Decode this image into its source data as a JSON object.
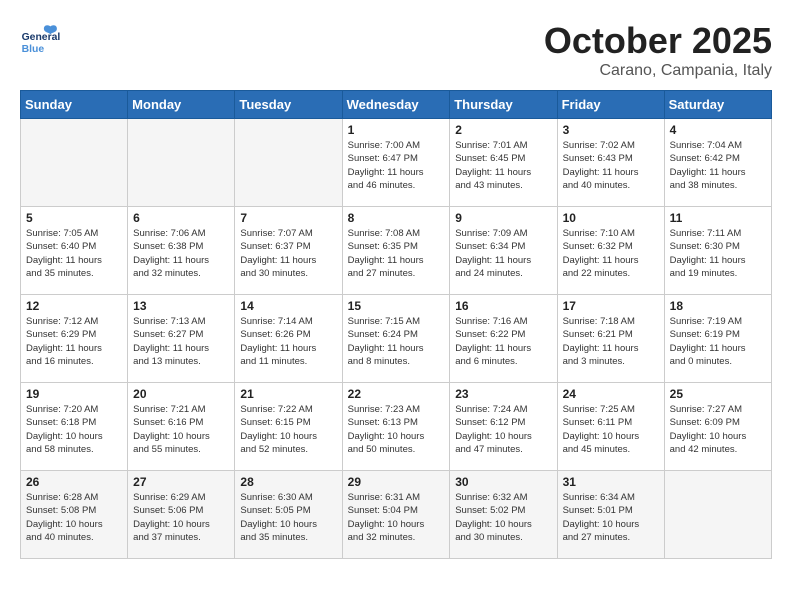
{
  "header": {
    "logo_general": "General",
    "logo_blue": "Blue",
    "month_title": "October 2025",
    "location": "Carano, Campania, Italy"
  },
  "weekdays": [
    "Sunday",
    "Monday",
    "Tuesday",
    "Wednesday",
    "Thursday",
    "Friday",
    "Saturday"
  ],
  "weeks": [
    [
      {
        "day": "",
        "info": ""
      },
      {
        "day": "",
        "info": ""
      },
      {
        "day": "",
        "info": ""
      },
      {
        "day": "1",
        "info": "Sunrise: 7:00 AM\nSunset: 6:47 PM\nDaylight: 11 hours\nand 46 minutes."
      },
      {
        "day": "2",
        "info": "Sunrise: 7:01 AM\nSunset: 6:45 PM\nDaylight: 11 hours\nand 43 minutes."
      },
      {
        "day": "3",
        "info": "Sunrise: 7:02 AM\nSunset: 6:43 PM\nDaylight: 11 hours\nand 40 minutes."
      },
      {
        "day": "4",
        "info": "Sunrise: 7:04 AM\nSunset: 6:42 PM\nDaylight: 11 hours\nand 38 minutes."
      }
    ],
    [
      {
        "day": "5",
        "info": "Sunrise: 7:05 AM\nSunset: 6:40 PM\nDaylight: 11 hours\nand 35 minutes."
      },
      {
        "day": "6",
        "info": "Sunrise: 7:06 AM\nSunset: 6:38 PM\nDaylight: 11 hours\nand 32 minutes."
      },
      {
        "day": "7",
        "info": "Sunrise: 7:07 AM\nSunset: 6:37 PM\nDaylight: 11 hours\nand 30 minutes."
      },
      {
        "day": "8",
        "info": "Sunrise: 7:08 AM\nSunset: 6:35 PM\nDaylight: 11 hours\nand 27 minutes."
      },
      {
        "day": "9",
        "info": "Sunrise: 7:09 AM\nSunset: 6:34 PM\nDaylight: 11 hours\nand 24 minutes."
      },
      {
        "day": "10",
        "info": "Sunrise: 7:10 AM\nSunset: 6:32 PM\nDaylight: 11 hours\nand 22 minutes."
      },
      {
        "day": "11",
        "info": "Sunrise: 7:11 AM\nSunset: 6:30 PM\nDaylight: 11 hours\nand 19 minutes."
      }
    ],
    [
      {
        "day": "12",
        "info": "Sunrise: 7:12 AM\nSunset: 6:29 PM\nDaylight: 11 hours\nand 16 minutes."
      },
      {
        "day": "13",
        "info": "Sunrise: 7:13 AM\nSunset: 6:27 PM\nDaylight: 11 hours\nand 13 minutes."
      },
      {
        "day": "14",
        "info": "Sunrise: 7:14 AM\nSunset: 6:26 PM\nDaylight: 11 hours\nand 11 minutes."
      },
      {
        "day": "15",
        "info": "Sunrise: 7:15 AM\nSunset: 6:24 PM\nDaylight: 11 hours\nand 8 minutes."
      },
      {
        "day": "16",
        "info": "Sunrise: 7:16 AM\nSunset: 6:22 PM\nDaylight: 11 hours\nand 6 minutes."
      },
      {
        "day": "17",
        "info": "Sunrise: 7:18 AM\nSunset: 6:21 PM\nDaylight: 11 hours\nand 3 minutes."
      },
      {
        "day": "18",
        "info": "Sunrise: 7:19 AM\nSunset: 6:19 PM\nDaylight: 11 hours\nand 0 minutes."
      }
    ],
    [
      {
        "day": "19",
        "info": "Sunrise: 7:20 AM\nSunset: 6:18 PM\nDaylight: 10 hours\nand 58 minutes."
      },
      {
        "day": "20",
        "info": "Sunrise: 7:21 AM\nSunset: 6:16 PM\nDaylight: 10 hours\nand 55 minutes."
      },
      {
        "day": "21",
        "info": "Sunrise: 7:22 AM\nSunset: 6:15 PM\nDaylight: 10 hours\nand 52 minutes."
      },
      {
        "day": "22",
        "info": "Sunrise: 7:23 AM\nSunset: 6:13 PM\nDaylight: 10 hours\nand 50 minutes."
      },
      {
        "day": "23",
        "info": "Sunrise: 7:24 AM\nSunset: 6:12 PM\nDaylight: 10 hours\nand 47 minutes."
      },
      {
        "day": "24",
        "info": "Sunrise: 7:25 AM\nSunset: 6:11 PM\nDaylight: 10 hours\nand 45 minutes."
      },
      {
        "day": "25",
        "info": "Sunrise: 7:27 AM\nSunset: 6:09 PM\nDaylight: 10 hours\nand 42 minutes."
      }
    ],
    [
      {
        "day": "26",
        "info": "Sunrise: 6:28 AM\nSunset: 5:08 PM\nDaylight: 10 hours\nand 40 minutes."
      },
      {
        "day": "27",
        "info": "Sunrise: 6:29 AM\nSunset: 5:06 PM\nDaylight: 10 hours\nand 37 minutes."
      },
      {
        "day": "28",
        "info": "Sunrise: 6:30 AM\nSunset: 5:05 PM\nDaylight: 10 hours\nand 35 minutes."
      },
      {
        "day": "29",
        "info": "Sunrise: 6:31 AM\nSunset: 5:04 PM\nDaylight: 10 hours\nand 32 minutes."
      },
      {
        "day": "30",
        "info": "Sunrise: 6:32 AM\nSunset: 5:02 PM\nDaylight: 10 hours\nand 30 minutes."
      },
      {
        "day": "31",
        "info": "Sunrise: 6:34 AM\nSunset: 5:01 PM\nDaylight: 10 hours\nand 27 minutes."
      },
      {
        "day": "",
        "info": ""
      }
    ]
  ]
}
